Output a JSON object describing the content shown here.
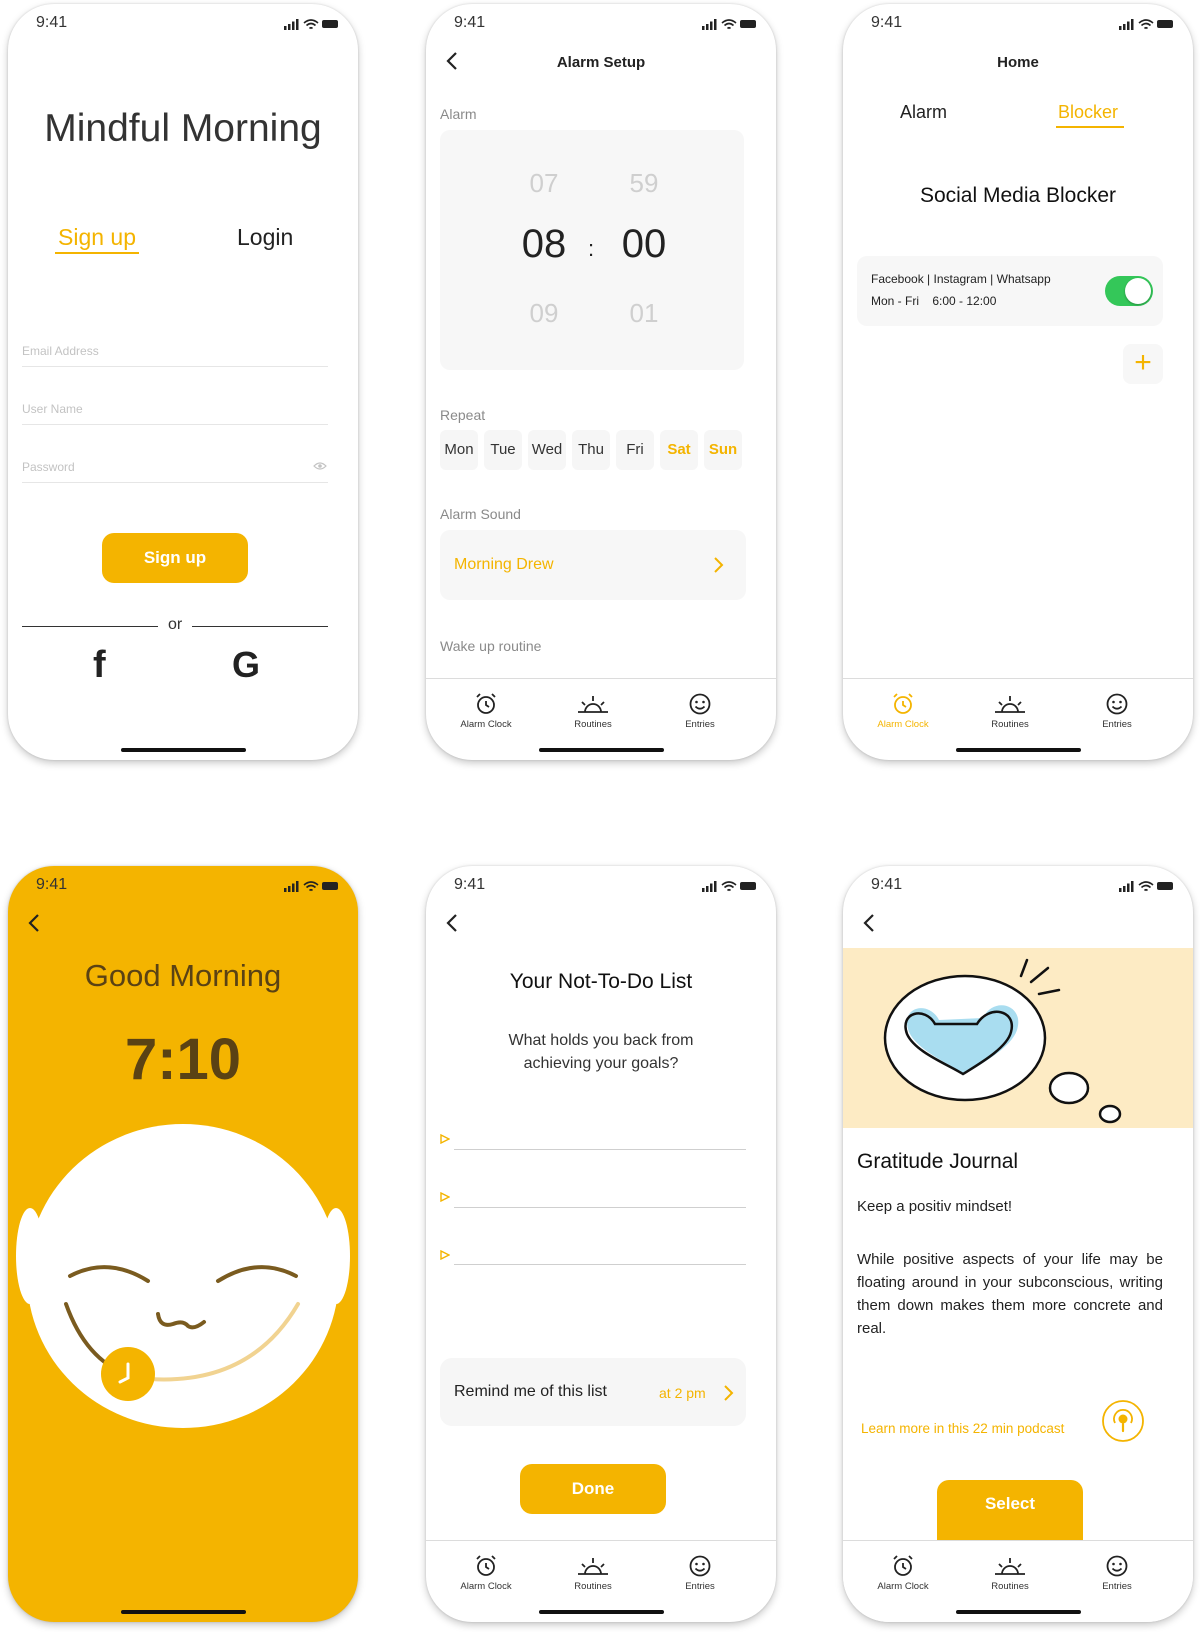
{
  "status_time": "9:41",
  "colors": {
    "accent": "#F4B400",
    "toggle_on": "#34C759",
    "illustration_bg": "#FDEBC4",
    "heart": "#A9DDF0"
  },
  "screen_signup": {
    "title": "Mindful Morning",
    "tab_signup": "Sign up",
    "tab_login": "Login",
    "email_placeholder": "Email Address",
    "username_placeholder": "User Name",
    "password_placeholder": "Password",
    "signup_button": "Sign up",
    "or": "or",
    "facebook": "f",
    "google": "G"
  },
  "screen_alarm_setup": {
    "title": "Alarm Setup",
    "alarm_label": "Alarm",
    "hour_prev": "07",
    "hour": "08",
    "hour_next": "09",
    "minute_prev": "59",
    "minute": "00",
    "minute_next": "01",
    "separator": ":",
    "repeat_label": "Repeat",
    "days": [
      "Mon",
      "Tue",
      "Wed",
      "Thu",
      "Fri",
      "Sat",
      "Sun"
    ],
    "alarm_sound_label": "Alarm Sound",
    "alarm_sound": "Morning Drew",
    "wakeup_label": "Wake up routine"
  },
  "tabbar": {
    "alarm": "Alarm Clock",
    "routines": "Routines",
    "entries": "Entries"
  },
  "screen_home": {
    "title": "Home",
    "tab_alarm": "Alarm",
    "tab_blocker": "Blocker",
    "section_title": "Social Media Blocker",
    "blocker_apps": "Facebook | Instagram | Whatsapp",
    "blocker_schedule": "Mon - Fri    6:00 - 12:00",
    "add": "+"
  },
  "screen_good_morning": {
    "greeting": "Good Morning",
    "time": "7:10"
  },
  "screen_not_todo": {
    "title": "Your Not-To-Do List",
    "subtitle_line1": "What holds you back from",
    "subtitle_line2": "achieving your goals?",
    "remind_label": "Remind me of this list",
    "remind_time": "at 2 pm",
    "done_button": "Done"
  },
  "screen_journal": {
    "title": "Gratitude Journal",
    "tagline": "Keep a positiv mindset!",
    "body": "While positive aspects of your life may be floating around in your subconscious, writing them down makes them more concrete and real.",
    "podcast_link": "Learn more in this 22 min podcast",
    "select_button": "Select"
  }
}
